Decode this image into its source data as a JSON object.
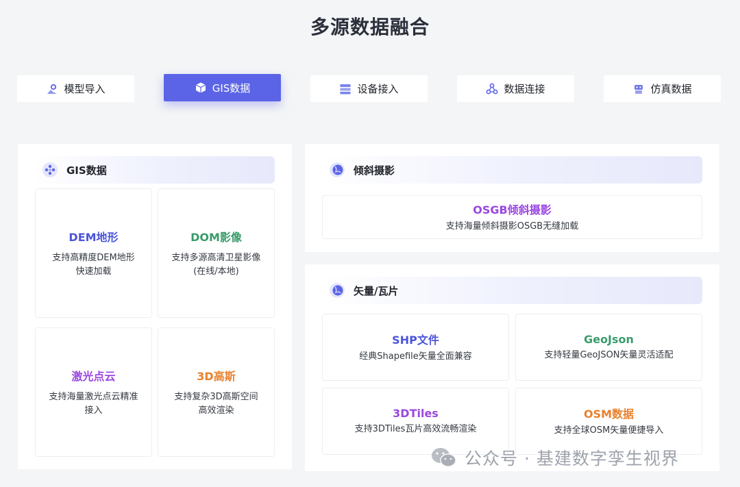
{
  "page": {
    "title": "多源数据融合"
  },
  "colors": {
    "accent": "#5b64e6",
    "blue": "#4b55d8",
    "green": "#3a9c6b",
    "purple": "#9a48e0",
    "orange": "#e8812d"
  },
  "tabs": [
    {
      "label": "模型导入",
      "icon": "model-import-icon",
      "active": false
    },
    {
      "label": "GIS数据",
      "icon": "cube-icon",
      "active": true
    },
    {
      "label": "设备接入",
      "icon": "device-icon",
      "active": false
    },
    {
      "label": "数据连接",
      "icon": "connection-icon",
      "active": false
    },
    {
      "label": "仿真数据",
      "icon": "robot-icon",
      "active": false
    }
  ],
  "gis": {
    "header": "GIS数据",
    "icon": "dots-icon",
    "cards": [
      {
        "title": "DEM地形",
        "desc": "支持高精度DEM地形\n快速加载",
        "color": "#4b55d8"
      },
      {
        "title": "DOM影像",
        "desc": "支持多源高清卫星影像\n(在线/本地)",
        "color": "#3a9c6b"
      },
      {
        "title": "激光点云",
        "desc": "支持海量激光点云精准\n接入",
        "color": "#9a48e0"
      },
      {
        "title": "3D高斯",
        "desc": "支持复杂3D高斯空间\n高效渲染",
        "color": "#e8812d"
      }
    ]
  },
  "oblique": {
    "header": "倾斜摄影",
    "icon": "globe-icon",
    "card": {
      "title": "OSGB倾斜摄影",
      "desc": "支持海量倾斜摄影OSGB无缝加载",
      "color": "#9a48e0"
    }
  },
  "vector": {
    "header": "矢量/瓦片",
    "icon": "globe-icon",
    "cards": [
      {
        "title": "SHP文件",
        "desc": "经典Shapefile矢量全面兼容",
        "color": "#4b55d8"
      },
      {
        "title": "GeoJson",
        "desc": "支持轻量GeoJSON矢量灵活适配",
        "color": "#3a9c6b"
      },
      {
        "title": "3DTiles",
        "desc": "支持3DTiles瓦片高效流畅渲染",
        "color": "#9a48e0"
      },
      {
        "title": "OSM数据",
        "desc": "支持全球OSM矢量便捷导入",
        "color": "#e8812d"
      }
    ]
  },
  "watermark": {
    "text": "公众号 · 基建数字孪生视界",
    "icon": "wechat-icon"
  }
}
